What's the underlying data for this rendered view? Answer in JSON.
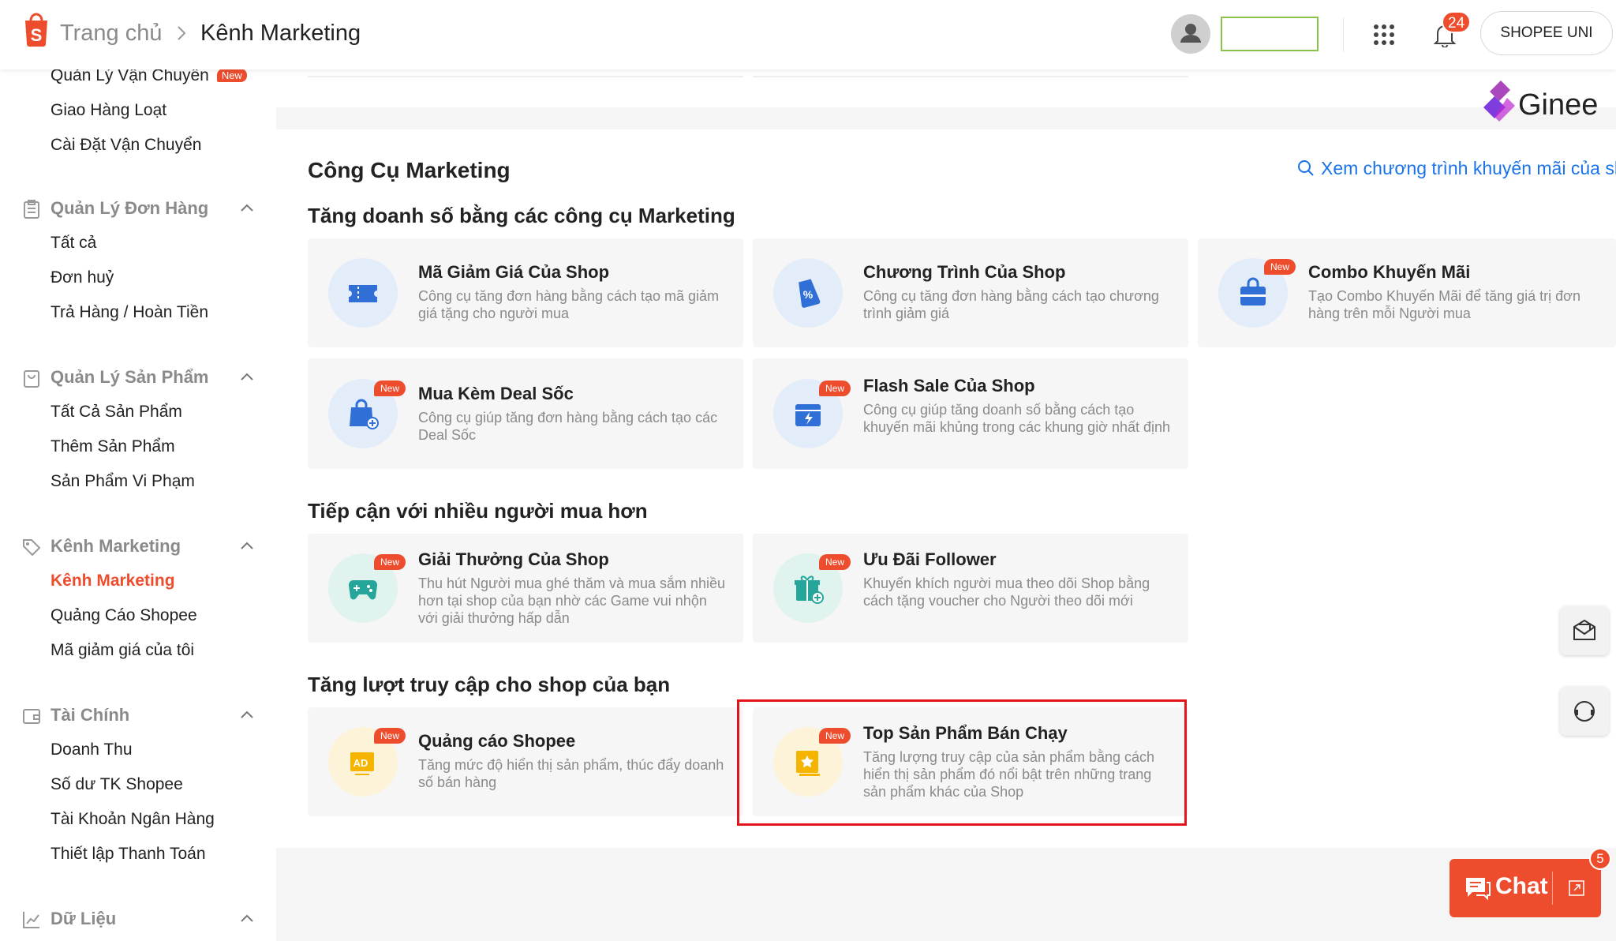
{
  "header": {
    "breadcrumb_home": "Trang chủ",
    "breadcrumb_current": "Kênh Marketing",
    "notification_count": "24",
    "shopee_uni_label": "SHOPEE UNI"
  },
  "brand_watermark": "Ginee",
  "sidebar": {
    "shipping_items": [
      {
        "label": "Quản Lý Vận Chuyển",
        "new_tag": "New"
      },
      {
        "label": "Giao Hàng Loạt"
      },
      {
        "label": "Cài Đặt Vận Chuyển"
      }
    ],
    "groups": [
      {
        "title": "Quản Lý Đơn Hàng",
        "icon": "clipboard-icon",
        "items": [
          "Tất cả",
          "Đơn huỷ",
          "Trả Hàng / Hoàn Tiền"
        ]
      },
      {
        "title": "Quản Lý Sản Phẩm",
        "icon": "bag-icon",
        "items": [
          "Tất Cả Sản Phẩm",
          "Thêm Sản Phẩm",
          "Sản Phẩm Vi Phạm"
        ]
      },
      {
        "title": "Kênh Marketing",
        "icon": "tag-icon",
        "items": [
          "Kênh Marketing",
          "Quảng Cáo Shopee",
          "Mã giảm giá của tôi"
        ],
        "active_item": "Kênh Marketing"
      },
      {
        "title": "Tài Chính",
        "icon": "wallet-icon",
        "items": [
          "Doanh Thu",
          "Số dư TK Shopee",
          "Tài Khoản Ngân Hàng",
          "Thiết lập Thanh Toán"
        ]
      },
      {
        "title": "Dữ Liệu",
        "icon": "chart-icon",
        "items": []
      }
    ]
  },
  "main": {
    "title": "Công Cụ Marketing",
    "promo_link": "Xem chương trình khuyến mãi của sh",
    "sections": [
      {
        "title": "Tăng doanh số bằng các công cụ Marketing",
        "tools": [
          {
            "title": "Mã Giảm Giá Của Shop",
            "desc": "Công cụ tăng đơn hàng bằng cách tạo mã giảm giá tặng cho người mua",
            "icon": "voucher-icon",
            "new": ""
          },
          {
            "title": "Chương Trình Của Shop",
            "desc": "Công cụ tăng đơn hàng bằng cách tạo chương trình giảm giá",
            "icon": "discount-tag-icon",
            "new": ""
          },
          {
            "title": "Combo Khuyến Mãi",
            "desc": "Tạo Combo Khuyến Mãi để tăng giá trị đơn hàng trên mỗi Người mua",
            "icon": "combo-bag-icon",
            "new": "New"
          },
          {
            "title": "Mua Kèm Deal Sốc",
            "desc": "Công cụ giúp tăng đơn hàng bằng cách tạo các Deal Sốc",
            "icon": "add-on-bag-icon",
            "new": "New"
          },
          {
            "title": "Flash Sale Của Shop",
            "desc": "Công cụ giúp tăng doanh số bằng cách tạo khuyến mãi khủng trong các khung giờ nhất định",
            "icon": "flash-sale-icon",
            "new": "New"
          }
        ]
      },
      {
        "title": "Tiếp cận với nhiều người mua hơn",
        "tools": [
          {
            "title": "Giải Thưởng Của Shop",
            "desc": "Thu hút Người mua ghé thăm và mua sắm nhiều hơn tại shop của bạn nhờ các Game vui nhộn với giải thưởng hấp dẫn",
            "icon": "gamepad-icon",
            "new": "New"
          },
          {
            "title": "Ưu Đãi Follower",
            "desc": "Khuyến khích người mua theo dõi Shop bằng cách tặng voucher cho Người theo dõi mới",
            "icon": "gift-icon",
            "new": "New"
          }
        ]
      },
      {
        "title": "Tăng lượt truy cập cho shop của bạn",
        "tools": [
          {
            "title": "Quảng cáo Shopee",
            "desc": "Tăng mức độ hiển thị sản phẩm, thúc đẩy doanh số bán hàng",
            "icon": "ad-icon",
            "new": "New"
          },
          {
            "title": "Top Sản Phẩm Bán Chạy",
            "desc": "Tăng lượng truy cập của sản phẩm bằng cách hiển thị sản phẩm đó nổi bật trên những trang sản phẩm khác của Shop",
            "icon": "top-product-icon",
            "new": "New"
          }
        ]
      }
    ]
  },
  "chat": {
    "label": "Chat",
    "badge": "5"
  },
  "colors": {
    "brand": "#ee4d2d",
    "link": "#1a73e8",
    "highlight": "#e3141b"
  }
}
